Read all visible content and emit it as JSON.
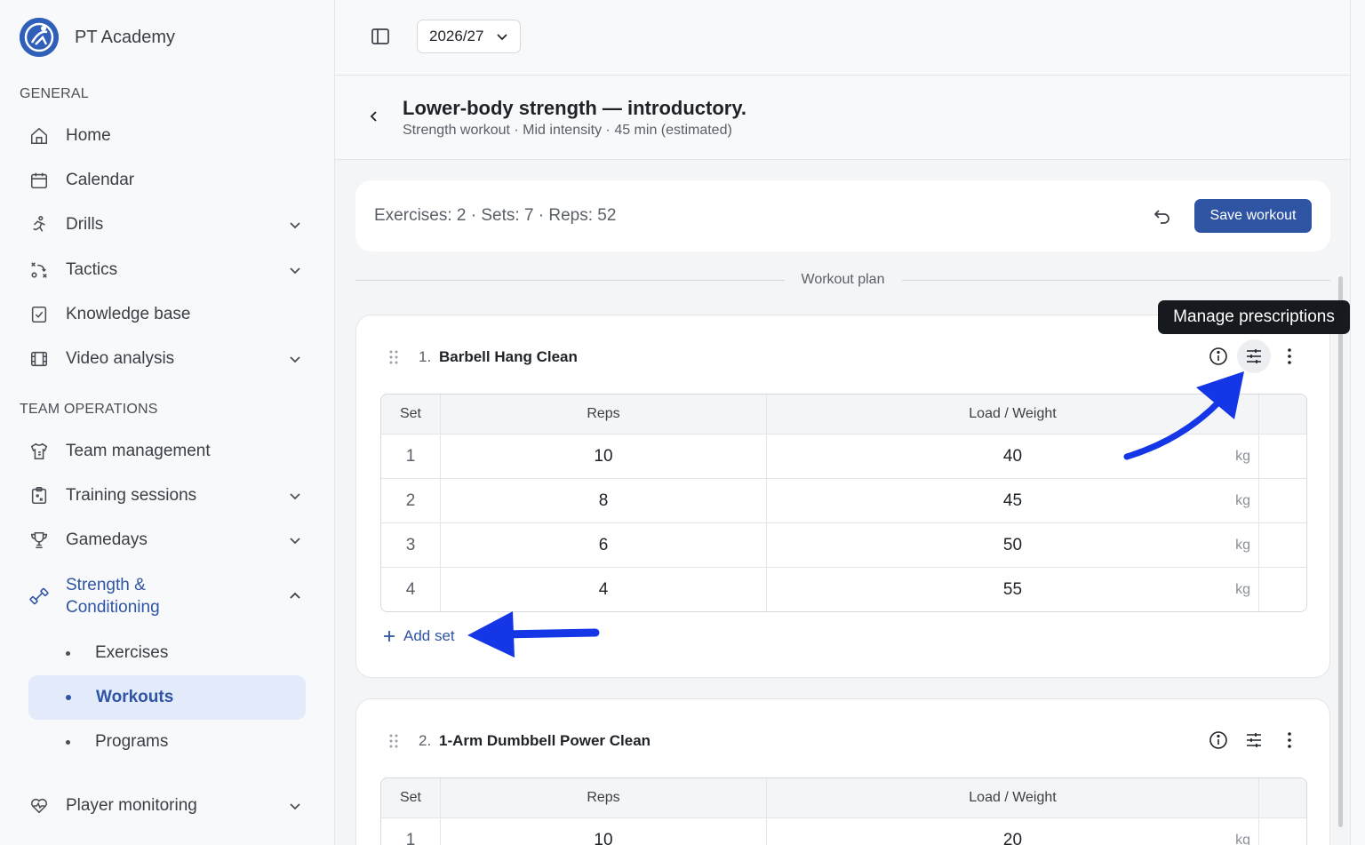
{
  "app": {
    "name": "PT Academy"
  },
  "sidebar": {
    "general_label": "GENERAL",
    "team_ops_label": "TEAM OPERATIONS",
    "items": [
      {
        "label": "Home",
        "icon": "home-icon"
      },
      {
        "label": "Calendar",
        "icon": "calendar-icon"
      },
      {
        "label": "Drills",
        "icon": "running-icon"
      },
      {
        "label": "Tactics",
        "icon": "tactics-icon"
      },
      {
        "label": "Knowledge base",
        "icon": "clipboard-check-icon"
      },
      {
        "label": "Video analysis",
        "icon": "film-icon"
      },
      {
        "label": "Team management",
        "icon": "jersey-icon"
      },
      {
        "label": "Training sessions",
        "icon": "clipboard-icon"
      },
      {
        "label": "Gamedays",
        "icon": "trophy-icon"
      },
      {
        "label_line1": "Strength &",
        "label_line2": "Conditioning",
        "icon": "dumbbell-icon"
      },
      {
        "label": "Player monitoring",
        "icon": "heart-pulse-icon"
      }
    ],
    "sub_items": [
      {
        "label": "Exercises"
      },
      {
        "label": "Workouts"
      },
      {
        "label": "Programs"
      }
    ]
  },
  "topbar": {
    "season": "2026/27"
  },
  "header": {
    "title": "Lower-body strength — introductory.",
    "subtitle": "Strength workout · Mid intensity · 45 min (estimated)"
  },
  "summary": {
    "text": "Exercises: 2 · Sets: 7 · Reps: 52",
    "save_label": "Save workout"
  },
  "plan_label": "Workout plan",
  "tooltip": "Manage prescriptions",
  "table_headers": {
    "set": "Set",
    "reps": "Reps",
    "load": "Load / Weight"
  },
  "add_set_label": "Add set",
  "exercises": [
    {
      "num": "1.",
      "name": "Barbell Hang Clean",
      "sets": [
        {
          "set": "1",
          "reps": "10",
          "load": "40",
          "unit": "kg"
        },
        {
          "set": "2",
          "reps": "8",
          "load": "45",
          "unit": "kg"
        },
        {
          "set": "3",
          "reps": "6",
          "load": "50",
          "unit": "kg"
        },
        {
          "set": "4",
          "reps": "4",
          "load": "55",
          "unit": "kg"
        }
      ]
    },
    {
      "num": "2.",
      "name": "1-Arm Dumbbell Power Clean",
      "sets": [
        {
          "set": "1",
          "reps": "10",
          "load": "20",
          "unit": "kg"
        }
      ]
    }
  ],
  "colors": {
    "accent": "#2f54a3",
    "annotation_arrow": "#1436e6"
  }
}
